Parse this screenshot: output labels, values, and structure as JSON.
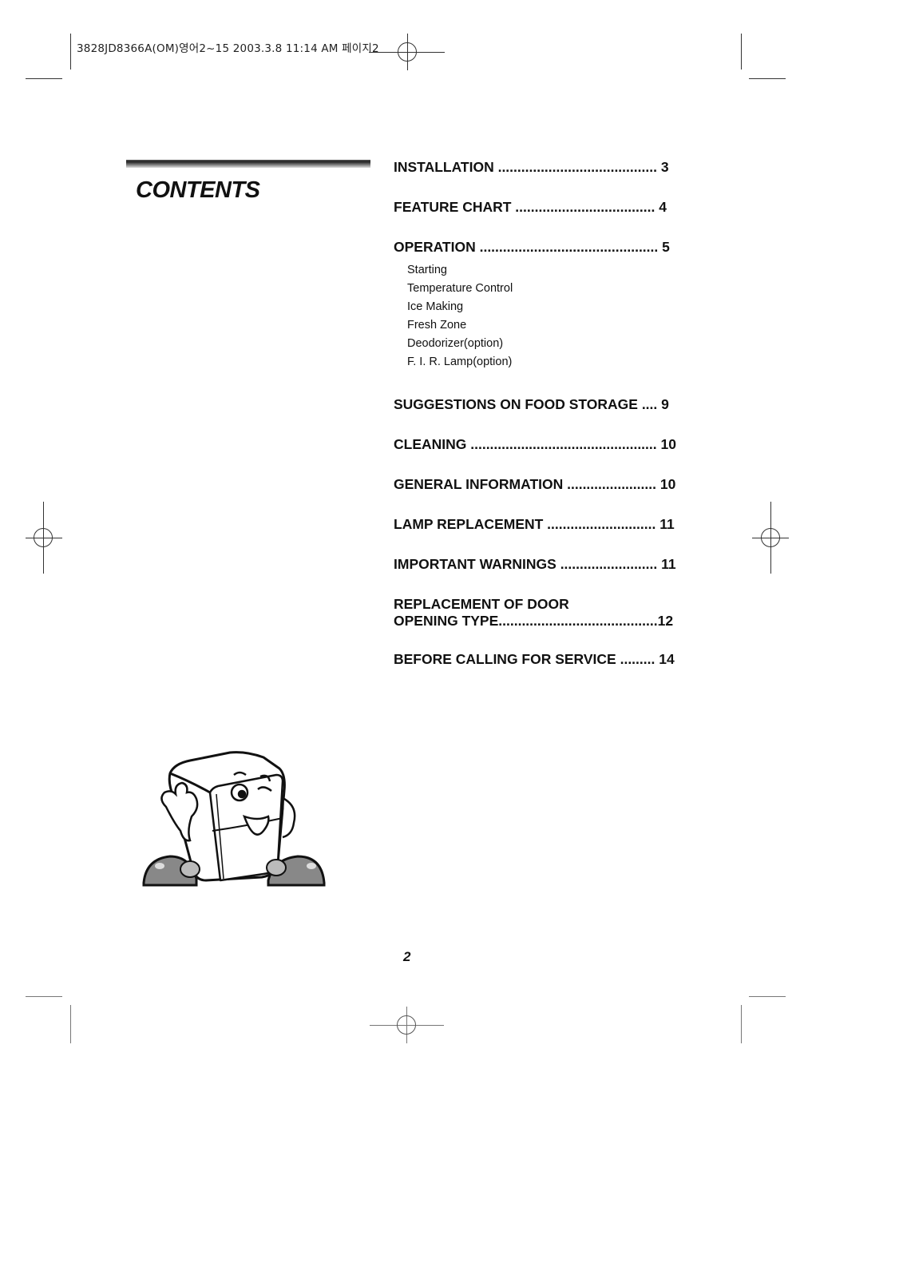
{
  "print_slug": "3828JD8366A(OM)영어2~15  2003.3.8 11:14 AM 페이지2",
  "title": "CONTENTS",
  "toc": [
    {
      "label": "INSTALLATION .........................................",
      "page": "3"
    },
    {
      "label": "FEATURE CHART  ....................................",
      "page": "4"
    },
    {
      "label": "OPERATION ..............................................",
      "page": "5"
    },
    {
      "label": "SUGGESTIONS ON FOOD STORAGE ....",
      "page": "9"
    },
    {
      "label": "CLEANING ................................................",
      "page": "10"
    },
    {
      "label": "GENERAL INFORMATION .......................",
      "page": "10"
    },
    {
      "label": "LAMP REPLACEMENT  ............................",
      "page": "11"
    },
    {
      "label": "IMPORTANT WARNINGS .........................",
      "page": "11"
    },
    {
      "label_line1": "REPLACEMENT OF DOOR",
      "label": "OPENING TYPE.........................................",
      "page": "12"
    },
    {
      "label": "BEFORE CALLING FOR SERVICE  .........",
      "page": "14"
    }
  ],
  "operation_subitems": [
    "Starting",
    "Temperature Control",
    "Ice Making",
    "Fresh Zone",
    "Deodorizer(option)",
    "F. I. R. Lamp(option)"
  ],
  "page_number": "2",
  "illustration": "refrigerator-mascot-winking"
}
